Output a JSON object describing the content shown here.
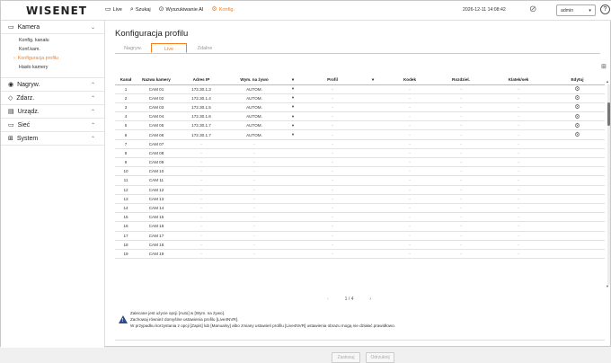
{
  "topbar": {
    "logo": "WISENET",
    "nav": [
      {
        "icon": "monitor-icon",
        "glyph": "▭",
        "label": "Live"
      },
      {
        "icon": "search-icon",
        "glyph": "⌕",
        "label": "Szukaj"
      },
      {
        "icon": "ai-search-icon",
        "glyph": "⊙",
        "label": "Wyszukiwanie AI"
      },
      {
        "icon": "gear-icon",
        "glyph": "⚙",
        "label": "Konfig."
      }
    ],
    "datetime": "2026-12-11 14:08:42",
    "user": "admin",
    "help": "?",
    "accent": "#f47e20"
  },
  "sidebar": {
    "camera": {
      "label": "Kamera",
      "items": [
        "Konfig. kanału",
        "Konf.kam.",
        "Konfiguracja profilu",
        "Hasło kamery"
      ]
    },
    "sections": [
      {
        "label": "Nagryw.",
        "glyph": "◉"
      },
      {
        "label": "Zdarz.",
        "glyph": "◇"
      },
      {
        "label": "Urządz.",
        "glyph": "▤"
      },
      {
        "label": "Sieć",
        "glyph": "▭"
      },
      {
        "label": "System",
        "glyph": "⊞"
      }
    ]
  },
  "main": {
    "title": "Konfiguracja profilu",
    "tabs": [
      "Nagryw.",
      "Live",
      "Zdalne"
    ],
    "active_tab": 1,
    "columns": [
      "Kanał",
      "Nazwa kamery",
      "Adres IP",
      "Wym. na żywo",
      "▾",
      "Profil",
      "▾",
      "Kodek",
      "Rozdziel.",
      "Klatek/sek",
      "Edytuj"
    ],
    "rows": [
      [
        "1",
        "CAM 01",
        "172.30.1.3",
        "AUTOM.",
        "▾",
        "-",
        "",
        "-",
        "-",
        "-",
        "gear"
      ],
      [
        "2",
        "CAM 02",
        "172.30.1.4",
        "AUTOM.",
        "▾",
        "-",
        "",
        "-",
        "-",
        "-",
        "gear"
      ],
      [
        "3",
        "CAM 03",
        "172.30.1.5",
        "AUTOM.",
        "▾",
        "-",
        "",
        "-",
        "-",
        "-",
        "gear"
      ],
      [
        "4",
        "CAM 04",
        "172.30.1.6",
        "AUTOM.",
        "▾",
        "-",
        "",
        "-",
        "-",
        "-",
        "gear"
      ],
      [
        "5",
        "CAM 05",
        "172.30.1.7",
        "AUTOM.",
        "▾",
        "-",
        "",
        "-",
        "-",
        "-",
        "gear"
      ],
      [
        "6",
        "CAM 06",
        "172.30.1.7",
        "AUTOM.",
        "▾",
        "-",
        "",
        "-",
        "-",
        "-",
        "gear"
      ],
      [
        "7",
        "CAM 07",
        "-",
        "-",
        "",
        "-",
        "",
        "-",
        "-",
        "-",
        ""
      ],
      [
        "8",
        "CAM 08",
        "-",
        "-",
        "",
        "-",
        "",
        "-",
        "-",
        "-",
        ""
      ],
      [
        "9",
        "CAM 09",
        "-",
        "-",
        "",
        "-",
        "",
        "-",
        "-",
        "-",
        ""
      ],
      [
        "10",
        "CAM 10",
        "-",
        "-",
        "",
        "-",
        "",
        "-",
        "-",
        "-",
        ""
      ],
      [
        "11",
        "CAM 11",
        "-",
        "-",
        "",
        "-",
        "",
        "-",
        "-",
        "-",
        ""
      ],
      [
        "12",
        "CAM 12",
        "-",
        "-",
        "",
        "-",
        "",
        "-",
        "-",
        "-",
        ""
      ],
      [
        "13",
        "CAM 13",
        "-",
        "-",
        "",
        "-",
        "",
        "-",
        "-",
        "-",
        ""
      ],
      [
        "14",
        "CAM 14",
        "-",
        "-",
        "",
        "-",
        "",
        "-",
        "-",
        "-",
        ""
      ],
      [
        "15",
        "CAM 15",
        "-",
        "-",
        "",
        "-",
        "",
        "-",
        "-",
        "-",
        ""
      ],
      [
        "16",
        "CAM 16",
        "-",
        "-",
        "",
        "-",
        "",
        "-",
        "-",
        "-",
        ""
      ],
      [
        "17",
        "CAM 17",
        "-",
        "-",
        "",
        "-",
        "",
        "-",
        "-",
        "-",
        ""
      ],
      [
        "18",
        "CAM 18",
        "-",
        "-",
        "",
        "-",
        "",
        "-",
        "-",
        "-",
        ""
      ],
      [
        "19",
        "CAM 19",
        "-",
        "-",
        "",
        "-",
        "",
        "-",
        "-",
        "-",
        ""
      ]
    ],
    "pager": {
      "prev": "‹",
      "page": "1 / 4",
      "next": "›"
    },
    "notes": [
      "Zalecane jest użycie opcji [Auto] w [Wym. na żywo].",
      "Zachowaj również domyślne ustawienia profilu [Live4NVR].",
      "W przypadku korzystania z opcji [Zapis] lub [Manualny] albo zmiany ustawień profilu [Live4NVR] ustawienia obrazu mogą nie działać prawidłowo."
    ],
    "buttons": {
      "apply": "Zastosuj",
      "cancel": "Odrzuknij"
    }
  }
}
